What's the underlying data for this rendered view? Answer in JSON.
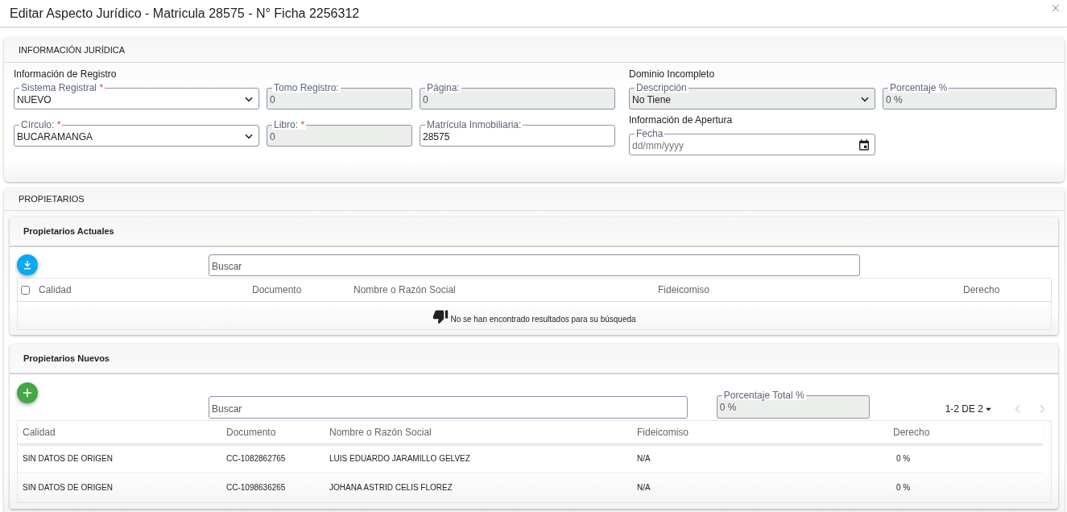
{
  "window": {
    "title": "Editar Aspecto Jurídico - Matricula 28575 - N° Ficha 2256312"
  },
  "informacion_juridica": {
    "title": "INFORMACIÓN JURÍDICA",
    "registro": {
      "title": "Información de Registro",
      "fields": [
        {
          "label": "Sistema Registral",
          "required_mark": "*",
          "kind": "select",
          "value": "NUEVO",
          "disabled": false
        },
        {
          "label": "Tomo Registro:",
          "kind": "text",
          "value": "0",
          "disabled": true
        },
        {
          "label": "Página:",
          "kind": "text",
          "value": "0",
          "disabled": true
        },
        {
          "label": "Círculo:",
          "required_mark": "*",
          "kind": "select",
          "value": "BUCARAMANGA",
          "disabled": false
        },
        {
          "label": "Libro:",
          "required_mark": "*",
          "kind": "text",
          "value": "0",
          "disabled": true
        },
        {
          "label": "Matrícula Inmobiliaria:",
          "kind": "text",
          "value": "28575",
          "disabled": false
        }
      ]
    },
    "dominio": {
      "title": "Dominio Incompleto",
      "fields": [
        {
          "label": "Descripción",
          "kind": "select",
          "value": "No Tiene",
          "disabled": true
        },
        {
          "label": "Porcentaje %",
          "kind": "text",
          "value": "0 %",
          "disabled": true
        }
      ]
    },
    "apertura": {
      "title": "Información de Apertura",
      "fields": [
        {
          "label": "Fecha",
          "kind": "date",
          "placeholder": "dd/mm/yyyy",
          "disabled": false
        }
      ]
    }
  },
  "propietarios": {
    "title": "PROPIETARIOS",
    "actuales": {
      "title": "Propietarios Actuales",
      "search": {
        "placeholder": "Buscar"
      },
      "table": {
        "select_all": {
          "checked": false
        },
        "columns": [
          "Calidad",
          "Documento",
          "Nombre o Razón Social",
          "Fideicomiso",
          "Derecho"
        ],
        "empty_message": "No se han encontrado resultados para su búsqueda"
      }
    },
    "nuevos": {
      "title": "Propietarios Nuevos",
      "search": {
        "placeholder": "Buscar"
      },
      "total": {
        "label": "Porcentaje Total %",
        "kind": "text",
        "value": "0 %",
        "disabled": true
      },
      "pagination": {
        "range": "1-2 DE 2",
        "prev_disabled": true,
        "next_disabled": true
      },
      "table": {
        "columns": [
          "Calidad",
          "Documento",
          "Nombre o Razón Social",
          "Fideicomiso",
          "Derecho"
        ],
        "rows": [
          {
            "cells": [
              "SIN DATOS DE ORIGEN",
              "CC-1082862765",
              "LUIS EDUARDO JARAMILLO GELVEZ",
              "N/A",
              "0 %"
            ]
          },
          {
            "cells": [
              "SIN DATOS DE ORIGEN",
              "CC-1098636265",
              "JOHANA ASTRID CELIS FLOREZ",
              "N/A",
              "0 %"
            ]
          }
        ]
      }
    }
  }
}
